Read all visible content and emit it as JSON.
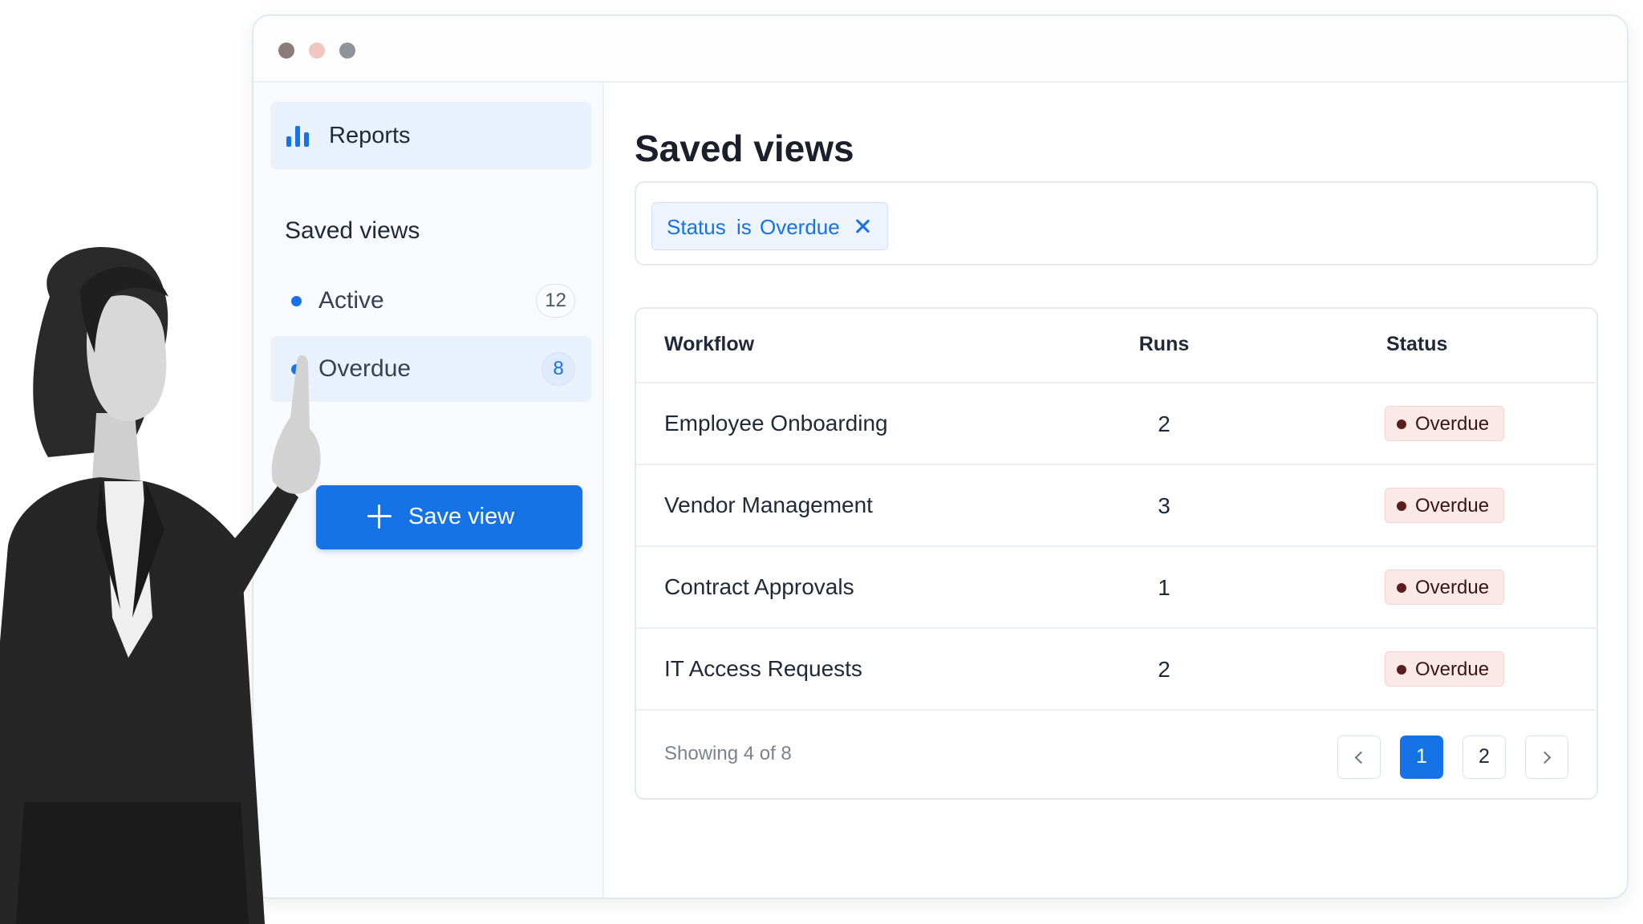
{
  "sidebar": {
    "reports_label": "Reports",
    "section_heading": "Saved views",
    "views": [
      {
        "label": "Active",
        "count": "12"
      },
      {
        "label": "Overdue",
        "count": "8"
      }
    ],
    "save_button_label": "Save view"
  },
  "main": {
    "title": "Saved views",
    "filter": {
      "field": "Status",
      "operator": "is",
      "value": "Overdue"
    },
    "table": {
      "columns": [
        "Workflow",
        "Runs",
        "Status"
      ],
      "rows": [
        {
          "workflow": "Employee Onboarding",
          "runs": "2",
          "status": "Overdue"
        },
        {
          "workflow": "Vendor Management",
          "runs": "3",
          "status": "Overdue"
        },
        {
          "workflow": "Contract Approvals",
          "runs": "1",
          "status": "Overdue"
        },
        {
          "workflow": "IT Access Requests",
          "runs": "2",
          "status": "Overdue"
        }
      ],
      "footer_text": "Showing 4 of 8",
      "pages": [
        "1",
        "2"
      ],
      "current_page": "1"
    }
  },
  "colors": {
    "accent": "#1573e6",
    "overdue_badge_bg": "#fbe9e8",
    "overdue_dot": "#5c1d1d"
  },
  "icons": {
    "reports": "bar-chart-icon",
    "add": "plus-icon",
    "remove_filter": "close-icon",
    "prev": "chevron-left-icon",
    "next": "chevron-right-icon"
  }
}
